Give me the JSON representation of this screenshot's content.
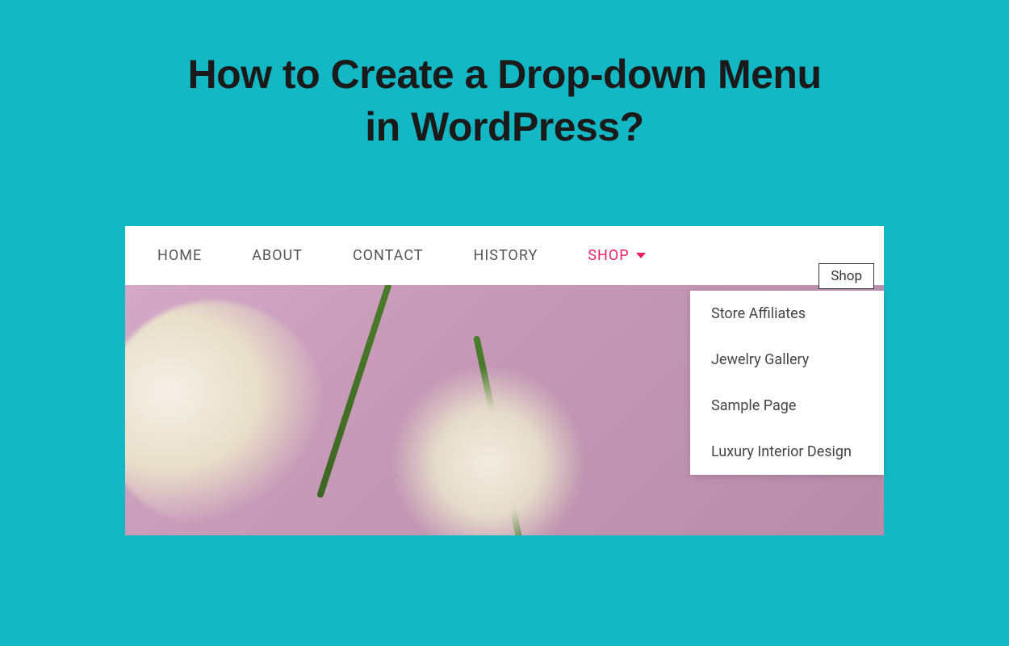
{
  "title_line1": "How to Create a Drop-down Menu",
  "title_line2": "in WordPress?",
  "nav": {
    "items": [
      {
        "label": "HOME"
      },
      {
        "label": "ABOUT"
      },
      {
        "label": "CONTACT"
      },
      {
        "label": "HISTORY"
      },
      {
        "label": "SHOP"
      }
    ]
  },
  "tooltip": "Shop",
  "dropdown": {
    "items": [
      {
        "label": "Store Affiliates"
      },
      {
        "label": "Jewelry Gallery"
      },
      {
        "label": "Sample Page"
      },
      {
        "label": "Luxury Interior Design"
      }
    ]
  }
}
